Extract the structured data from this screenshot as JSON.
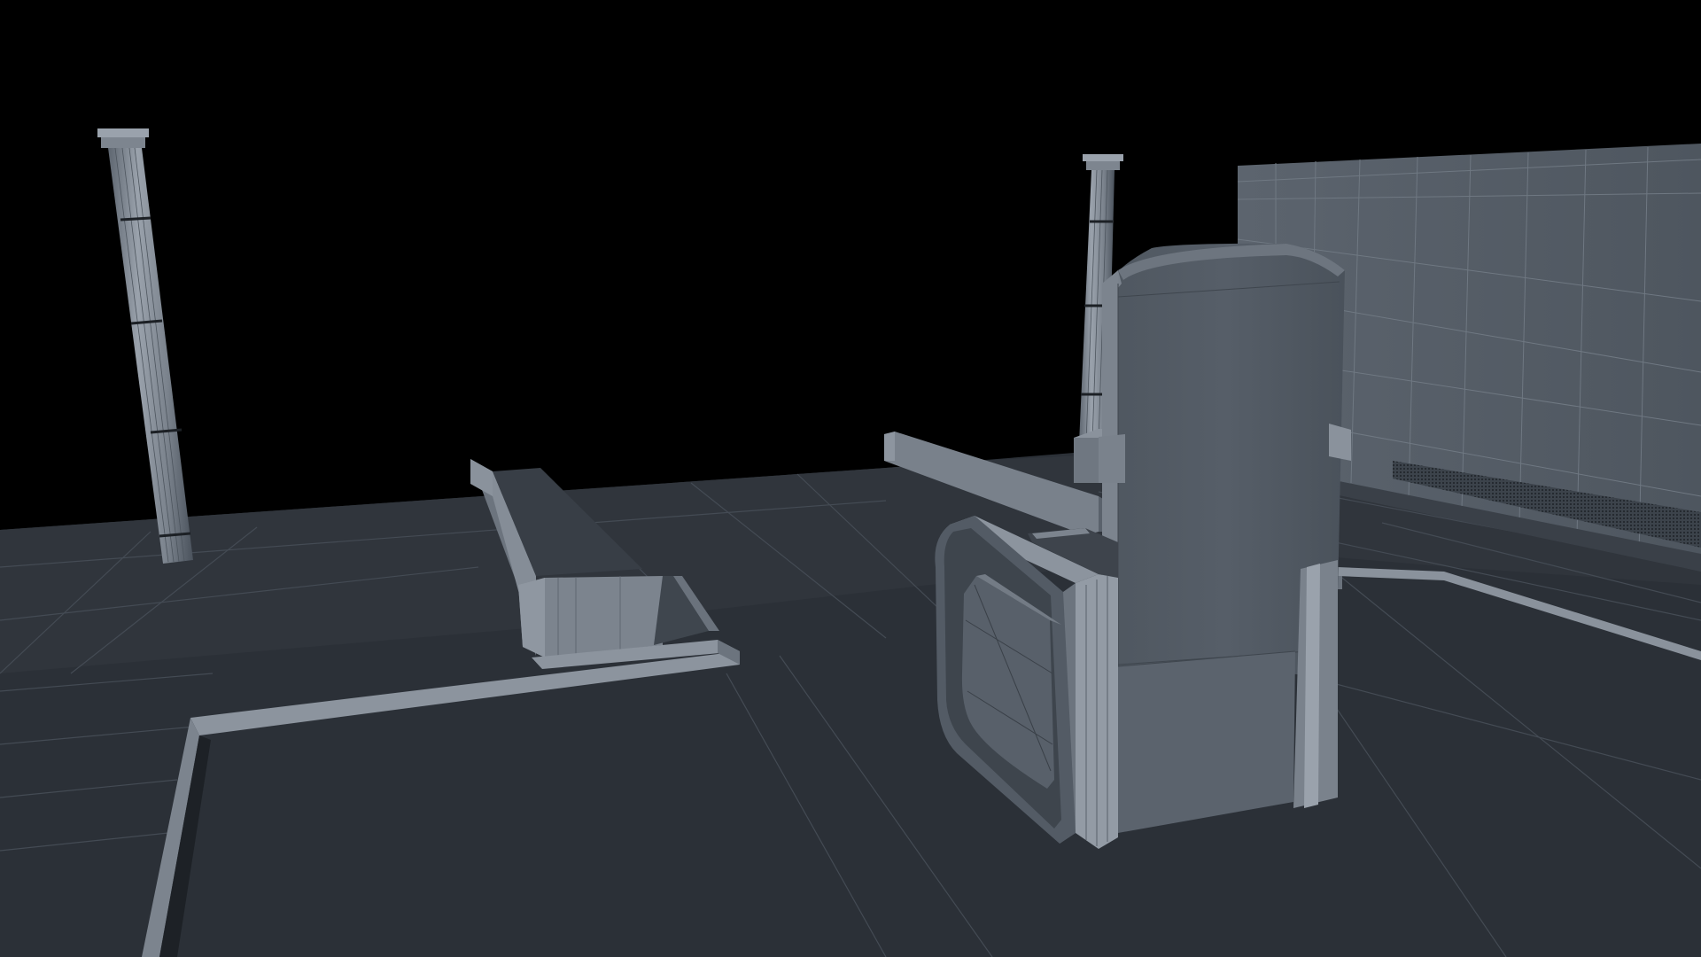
{
  "scene": {
    "background_color": "#000000",
    "floor_color": "#2a2f36",
    "floor_edge_color": "#7f8893",
    "wireframe_color": "#5d6570",
    "object_light_color": "#8a929c",
    "object_mid_color": "#6a727c",
    "object_dark_color": "#4b535d",
    "objects": [
      "floor-plane",
      "left-column",
      "center-column",
      "right-wall",
      "back-ledge",
      "mid-ledge",
      "l-shaped-step",
      "armchair"
    ]
  }
}
